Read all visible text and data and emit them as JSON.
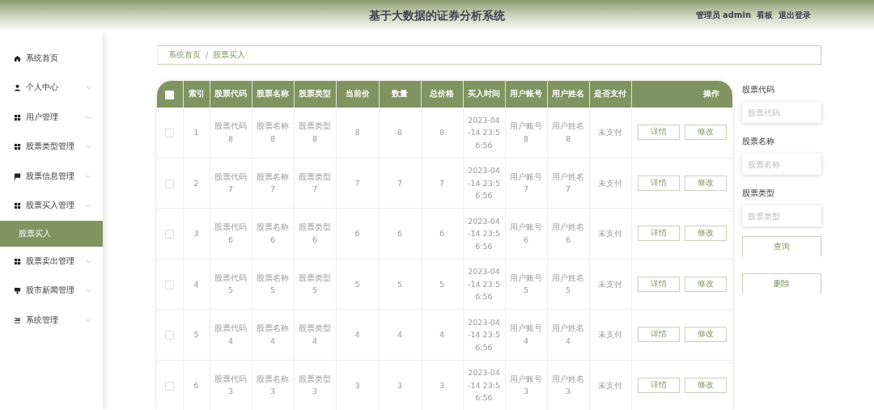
{
  "header": {
    "title": "基于大数据的证券分析系统",
    "user": "管理员 admin",
    "links": [
      "看板",
      "退出登录"
    ]
  },
  "sidebar": {
    "items": [
      {
        "label": "系统首页"
      },
      {
        "label": "个人中心",
        "expanded": false
      },
      {
        "label": "用户管理",
        "expanded": false
      },
      {
        "label": "股票类型管理",
        "expanded": false
      },
      {
        "label": "股票信息管理",
        "expanded": false
      },
      {
        "label": "股票买入管理",
        "expanded": true,
        "children": [
          {
            "label": "股票买入",
            "selected": true
          }
        ]
      },
      {
        "label": "股票卖出管理",
        "expanded": false
      },
      {
        "label": "股市新闻管理",
        "expanded": false
      },
      {
        "label": "系统管理",
        "expanded": false
      }
    ]
  },
  "breadcrumb": [
    "系统首页",
    "股票买入"
  ],
  "breadcrumb_separator": "/",
  "table": {
    "select_all_checked": false,
    "columns": [
      "索引",
      "股票代码",
      "股票名称",
      "股票类型",
      "当前价",
      "数量",
      "总价格",
      "买入时间",
      "用户账号",
      "用户姓名",
      "是否支付",
      "操作"
    ],
    "rows": [
      {
        "checked": false,
        "cells": [
          "1",
          "股票代码8",
          "股票名称8",
          "股票类型8",
          "8",
          "8",
          "8",
          "2023-04-14 23:56:56",
          "用户账号8",
          "用户姓名8",
          "未支付"
        ],
        "actions": [
          "详情",
          "修改"
        ]
      },
      {
        "checked": false,
        "cells": [
          "2",
          "股票代码7",
          "股票名称7",
          "股票类型7",
          "7",
          "7",
          "7",
          "2023-04-14 23:56:56",
          "用户账号7",
          "用户姓名7",
          "未支付"
        ],
        "actions": [
          "详情",
          "修改"
        ]
      },
      {
        "checked": false,
        "cells": [
          "3",
          "股票代码6",
          "股票名称6",
          "股票类型6",
          "6",
          "6",
          "6",
          "2023-04-14 23:56:56",
          "用户账号6",
          "用户姓名6",
          "未支付"
        ],
        "actions": [
          "详情",
          "修改"
        ]
      },
      {
        "checked": false,
        "cells": [
          "4",
          "股票代码5",
          "股票名称5",
          "股票类型5",
          "5",
          "5",
          "5",
          "2023-04-14 23:56:56",
          "用户账号5",
          "用户姓名5",
          "未支付"
        ],
        "actions": [
          "详情",
          "修改"
        ]
      },
      {
        "checked": false,
        "cells": [
          "5",
          "股票代码4",
          "股票名称4",
          "股票类型4",
          "4",
          "4",
          "4",
          "2023-04-14 23:56:56",
          "用户账号4",
          "用户姓名4",
          "未支付"
        ],
        "actions": [
          "详情",
          "修改"
        ]
      },
      {
        "checked": false,
        "cells": [
          "6",
          "股票代码3",
          "股票名称3",
          "股票类型3",
          "3",
          "3",
          "3",
          "2023-04-14 23:56:56",
          "用户账号3",
          "用户姓名3",
          "未支付"
        ],
        "actions": [
          "详情",
          "修改"
        ]
      }
    ]
  },
  "search": {
    "fields": [
      {
        "label": "股票代码",
        "placeholder": "股票代码"
      },
      {
        "label": "股票名称",
        "placeholder": "股票名称"
      },
      {
        "label": "股票类型",
        "placeholder": "股票类型"
      }
    ],
    "buttons": [
      "查询",
      "删除"
    ]
  }
}
